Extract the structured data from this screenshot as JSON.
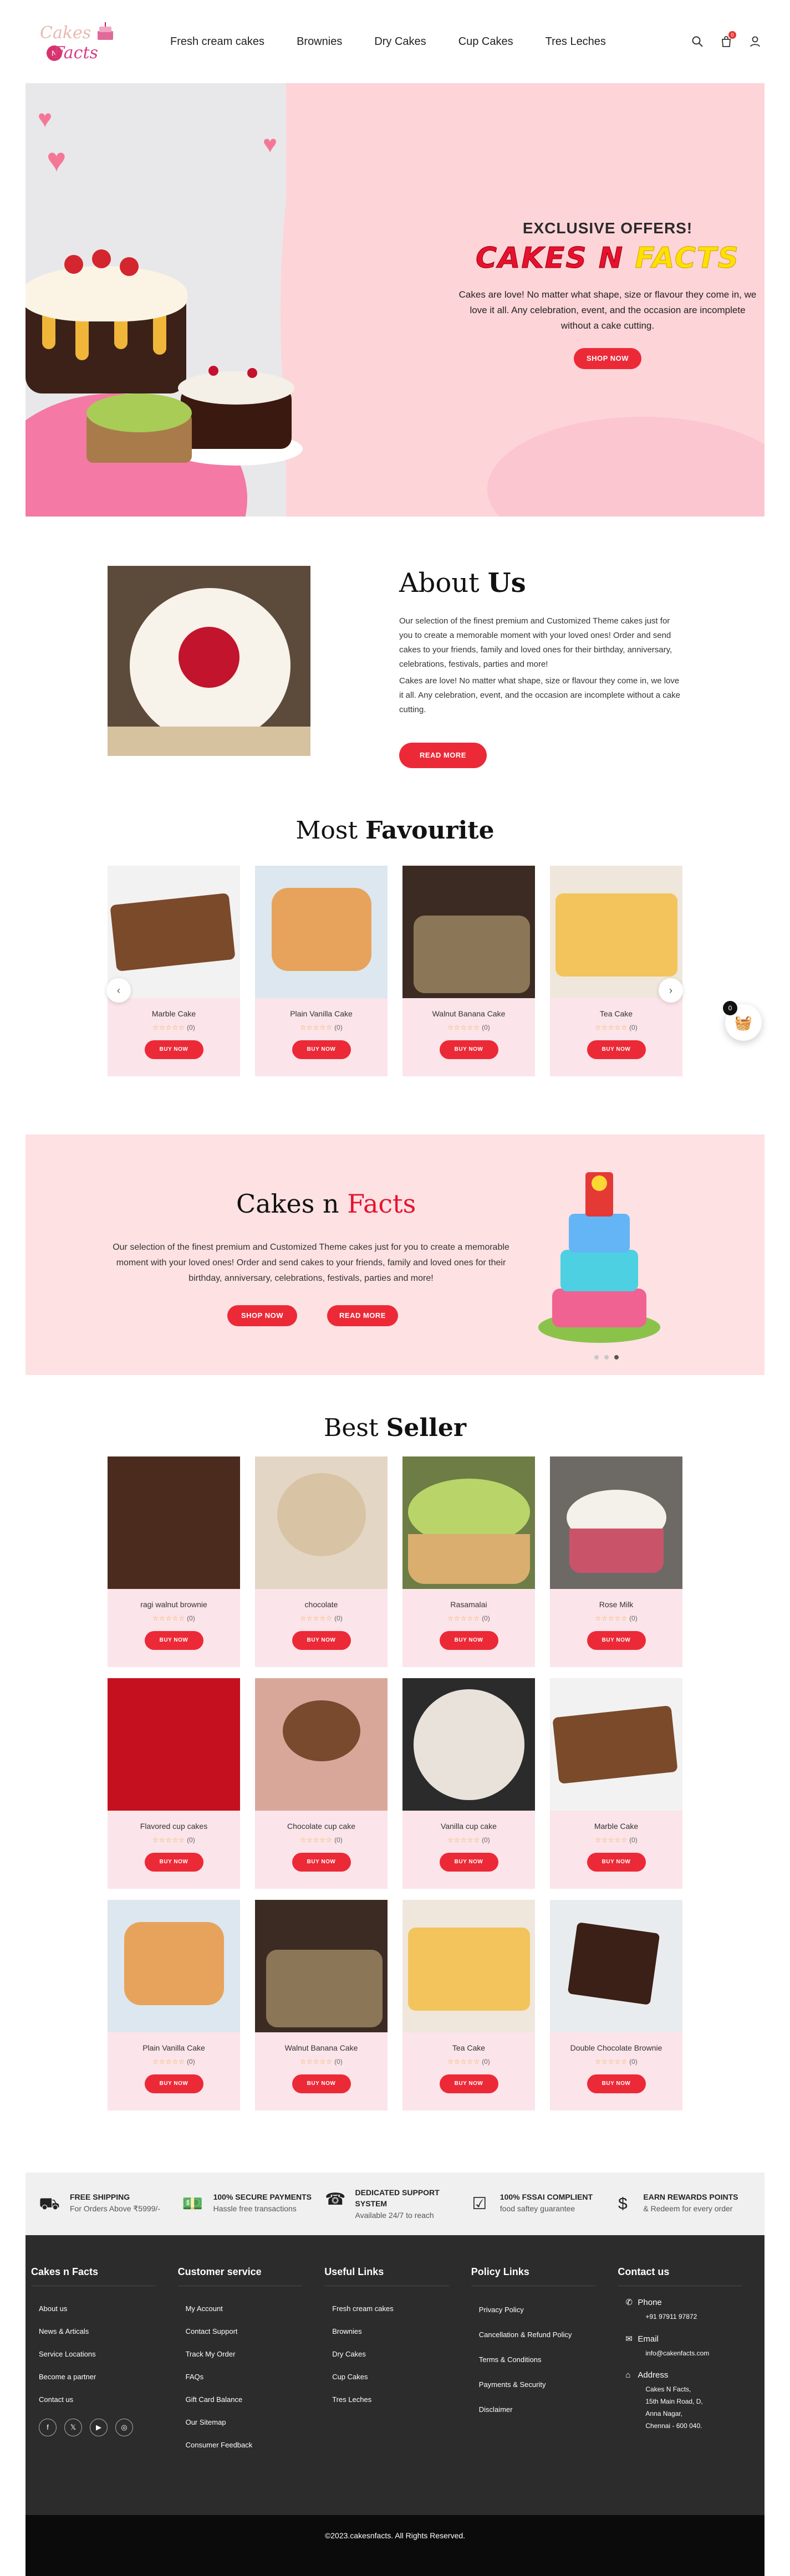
{
  "header": {
    "logo_top": "Cakes",
    "logo_mid": "N",
    "logo_bottom": "Facts",
    "nav": [
      "Fresh cream cakes",
      "Brownies",
      "Dry Cakes",
      "Cup Cakes",
      "Tres Leches"
    ],
    "cart_count": "0"
  },
  "hero": {
    "eyebrow": "EXCLUSIVE OFFERS!",
    "title_part1": "CAKES N ",
    "title_part2": "FACTS",
    "text": "Cakes are love! No matter what shape, size or flavour they come in, we love it all. Any celebration, event, and the occasion are incomplete without a cake cutting.",
    "button": "SHOP NOW"
  },
  "about": {
    "title_light": "About ",
    "title_bold": "Us",
    "p1": "Our selection of the finest premium and Customized Theme cakes just for you to create a memorable moment with your loved ones!  Order and send cakes to your friends, family and loved ones for their birthday, anniversary, celebrations, festivals, parties and more!",
    "p2": "Cakes are love! No matter what shape, size or flavour they come in, we love it all. Any celebration, event, and the occasion are incomplete without a cake cutting.",
    "button": "READ MORE"
  },
  "favourite": {
    "title_light": "Most ",
    "title_bold": "Favourite",
    "items": [
      {
        "name": "Marble Cake",
        "reviews": "(0)",
        "button": "BUY NOW"
      },
      {
        "name": "Plain Vanilla Cake",
        "reviews": "(0)",
        "button": "BUY NOW"
      },
      {
        "name": "Walnut Banana Cake",
        "reviews": "(0)",
        "button": "BUY NOW"
      },
      {
        "name": "Tea Cake",
        "reviews": "(0)",
        "button": "BUY NOW"
      }
    ]
  },
  "promo": {
    "title_black": "Cakes n ",
    "title_red": "Facts",
    "text": "Our selection of the finest premium and Customized Theme cakes just for you to create a memorable moment with your loved ones!  Order and send cakes to your friends, family and loved ones for their birthday, anniversary, celebrations, festivals, parties and more!",
    "button1": "SHOP NOW",
    "button2": "READ MORE"
  },
  "float_cart_count": "0",
  "best": {
    "title_light": "Best ",
    "title_bold": "Seller",
    "rows": [
      [
        {
          "name": "ragi walnut brownie",
          "reviews": "(0)",
          "button": "BUY NOW"
        },
        {
          "name": "chocolate",
          "reviews": "(0)",
          "button": "BUY NOW"
        },
        {
          "name": "Rasamalai",
          "reviews": "(0)",
          "button": "BUY NOW"
        },
        {
          "name": "Rose Milk",
          "reviews": "(0)",
          "button": "BUY NOW"
        }
      ],
      [
        {
          "name": "Flavored cup cakes",
          "reviews": "(0)",
          "button": "BUY NOW"
        },
        {
          "name": "Chocolate cup cake",
          "reviews": "(0)",
          "button": "BUY NOW"
        },
        {
          "name": "Vanilla cup cake",
          "reviews": "(0)",
          "button": "BUY NOW"
        },
        {
          "name": "Marble Cake",
          "reviews": "(0)",
          "button": "BUY NOW"
        }
      ],
      [
        {
          "name": "Plain Vanilla Cake",
          "reviews": "(0)",
          "button": "BUY NOW"
        },
        {
          "name": "Walnut Banana Cake",
          "reviews": "(0)",
          "button": "BUY NOW"
        },
        {
          "name": "Tea Cake",
          "reviews": "(0)",
          "button": "BUY NOW"
        },
        {
          "name": "Double Chocolate Brownie",
          "reviews": "(0)",
          "button": "BUY NOW"
        }
      ]
    ]
  },
  "features": [
    {
      "title": "FREE SHIPPING",
      "sub": "For Orders Above ₹5999/-",
      "icon": "truck-icon"
    },
    {
      "title": "100% SECURE PAYMENTS",
      "sub": "Hassle free transactions",
      "icon": "money-icon"
    },
    {
      "title": "DEDICATED SUPPORT SYSTEM",
      "sub": "Available 24/7 to reach",
      "icon": "support-icon"
    },
    {
      "title": "100% FSSAI COMPLIENT",
      "sub": "food saftey guarantee",
      "icon": "check-icon"
    },
    {
      "title": "EARN REWARDS POINTS",
      "sub": "& Redeem for every order",
      "icon": "rewards-icon"
    }
  ],
  "footer": {
    "col1": {
      "title": "Cakes n Facts",
      "links": [
        "About us",
        "News & Articals",
        "Service Locations",
        "Become a partner",
        "Contact us"
      ]
    },
    "col2": {
      "title": "Customer service",
      "links": [
        "My Account",
        "Contact Support",
        "Track My Order",
        "FAQs",
        "Gift Card Balance",
        "Our Sitemap",
        "Consumer Feedback"
      ]
    },
    "col3": {
      "title": "Useful Links",
      "links": [
        "Fresh cream cakes",
        "Brownies",
        "Dry Cakes",
        "Cup Cakes",
        "Tres Leches"
      ]
    },
    "col4": {
      "title": "Policy Links",
      "links": [
        "Privacy Policy",
        "Cancellation & Refund Policy",
        "Terms & Conditions",
        "Payments & Security",
        "Disclaimer"
      ]
    },
    "contact": {
      "title": "Contact us",
      "phone_label": "Phone",
      "phone": "+91 97911 97872",
      "email_label": "Email",
      "email": "info@cakenfacts.com",
      "address_label": "Address",
      "address": [
        "Cakes N Facts,",
        "15th Main Road, D,",
        "Anna Nagar,",
        "Chennai - 600 040."
      ]
    },
    "copyright": "©2023.cakesnfacts. All Rights Reserved."
  }
}
